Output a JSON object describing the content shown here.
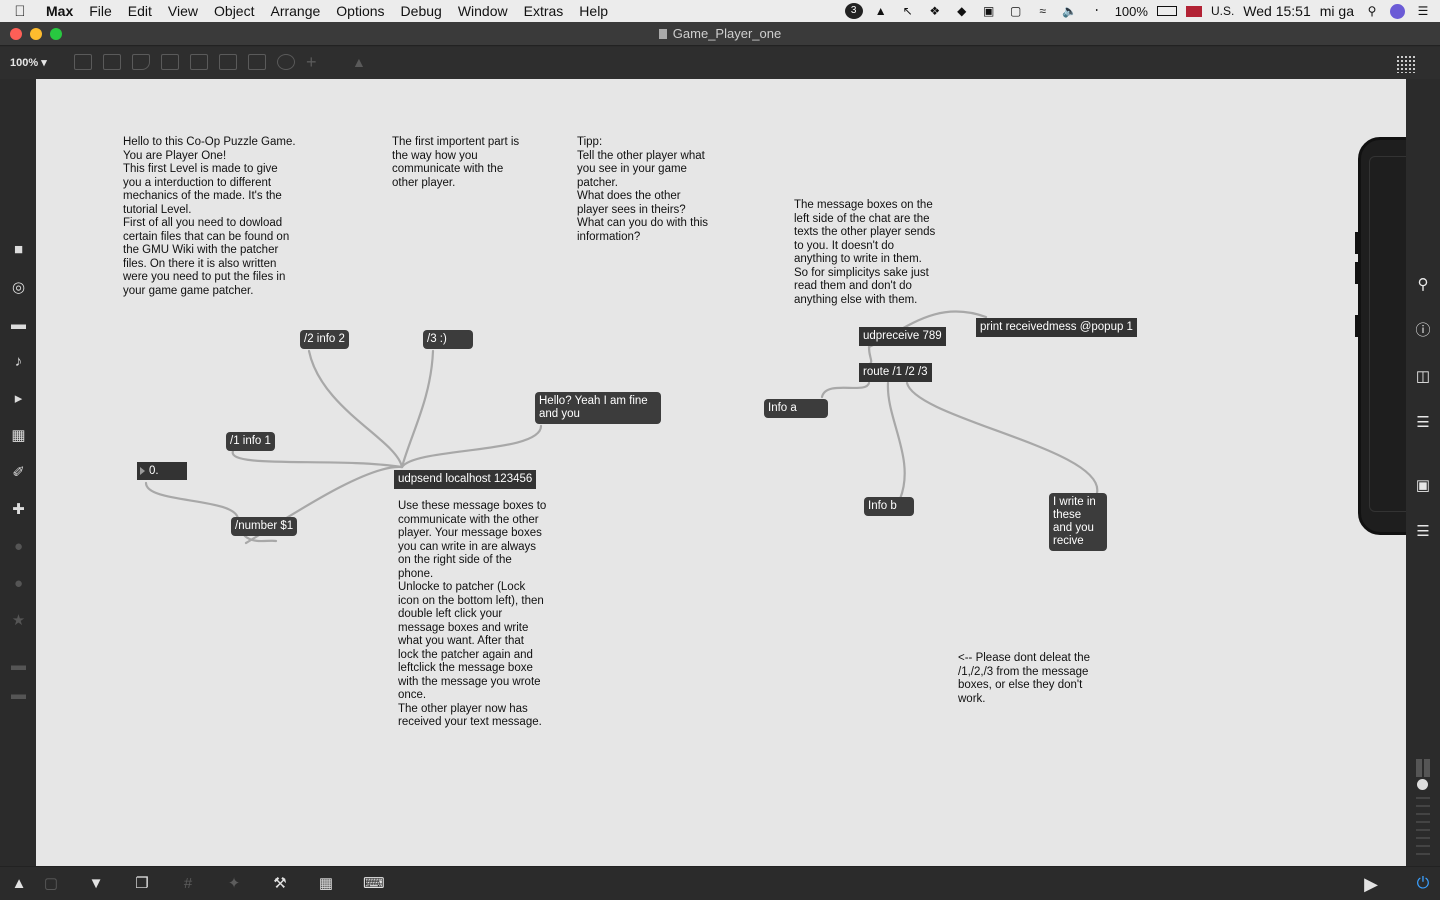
{
  "menubar": {
    "apple": "",
    "items": [
      "Max",
      "File",
      "Edit",
      "View",
      "Object",
      "Arrange",
      "Options",
      "Debug",
      "Window",
      "Extras",
      "Help"
    ],
    "battery": "100%",
    "input_source": "U.S.",
    "clock": "Wed 15:51",
    "user": "mi ga",
    "badge_count": "3"
  },
  "window": {
    "title": "Game_Player_one"
  },
  "toolbar": {
    "zoom": "100%"
  },
  "patcher": {
    "comments": {
      "intro": "Hello to this Co-Op Puzzle Game.\nYou are Player One!\nThis first Level is made to give\nyou a interduction to different\nmechanics of the made. It's the\ntutorial Level.\nFirst of all you need to dowload\ncertain files that can be found on\nthe GMU Wiki with the patcher\nfiles. On there it is also written\nwere you need to put the files in\nyour game game patcher.",
      "important": "The first importent part is\nthe way how you\ncommunicate with the\nother player.",
      "tipp": "Tipp:\nTell the other player what\nyou see in your game\npatcher.\nWhat does the other\nplayer sees in theirs?\nWhat can you do with this\ninformation?",
      "message_boxes": "The message boxes on the\nleft side of the chat are the\ntexts the other player sends\nto you. It doesn't do\nanything to write in them.\nSo for simplicitys sake just\nread them and don't do\nanything else with them.",
      "usage": "Use these message boxes to\ncommunicate with the other\nplayer. Your message boxes\nyou can write in are always\non the right side of the\nphone.\nUnlocke to patcher (Lock\nicon on the bottom left), then\ndouble left click your\nmessage boxes and write\nwhat you want. After that\nlock the patcher again and\nleftclick the message boxe\nwith the message you wrote\nonce.\nThe other player now has\nreceived your text message.",
      "warning": "<-- Please dont deleat the\n/1,/2,/3 from the message\nboxes, or else they don't\nwork."
    },
    "objects": {
      "udpsend": "udpsend localhost 123456",
      "udpreceive": "udpreceive 789",
      "route": "route /1 /2 /3",
      "print": "print receivedmess @popup 1"
    },
    "messages": {
      "info2": "/2 info 2",
      "smile": "/3 :)",
      "hello": "Hello? Yeah I am fine\nand you",
      "info1": "/1 info 1",
      "number": "/number $1",
      "info_a": "Info a",
      "info_b": "Info b",
      "iwrite": "I write in\nthese\nand you\nrecive"
    },
    "number_box": "0."
  },
  "colors": {
    "canvas": "#e6e6e6",
    "object": "#333333",
    "cord": "#a8a8a8",
    "power": "#3aa0ff"
  }
}
